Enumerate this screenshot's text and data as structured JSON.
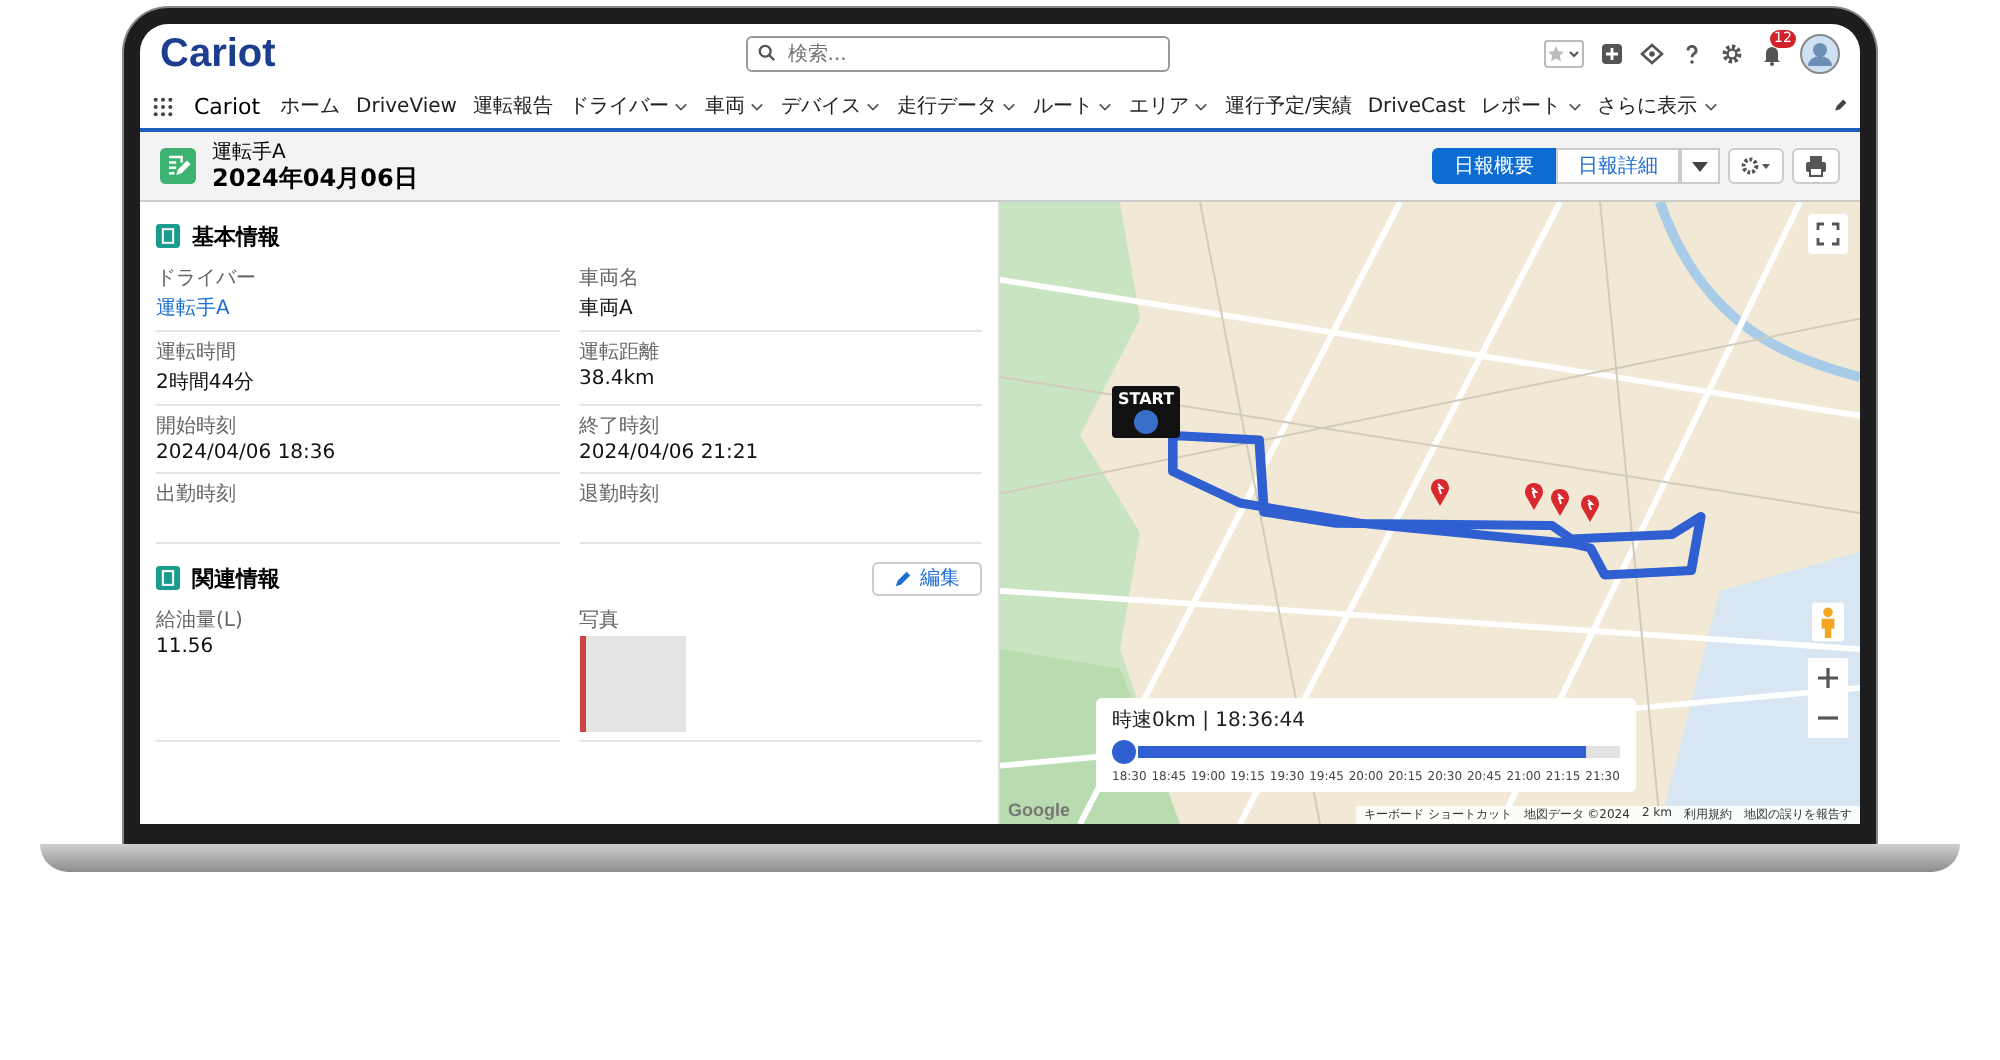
{
  "top_bar": {
    "logo": "Cariot",
    "search": {
      "placeholder": "検索..."
    },
    "notification_count": "12"
  },
  "nav": {
    "app_name": "Cariot",
    "items": [
      {
        "label": "ホーム",
        "has_menu": false
      },
      {
        "label": "DriveView",
        "has_menu": false
      },
      {
        "label": "運転報告",
        "has_menu": false
      },
      {
        "label": "ドライバー",
        "has_menu": true
      },
      {
        "label": "車両",
        "has_menu": true
      },
      {
        "label": "デバイス",
        "has_menu": true
      },
      {
        "label": "走行データ",
        "has_menu": true
      },
      {
        "label": "ルート",
        "has_menu": true
      },
      {
        "label": "エリア",
        "has_menu": true
      },
      {
        "label": "運行予定/実績",
        "has_menu": false
      },
      {
        "label": "DriveCast",
        "has_menu": false
      },
      {
        "label": "レポート",
        "has_menu": true
      },
      {
        "label": "さらに表示",
        "has_menu": true
      }
    ]
  },
  "record": {
    "object_label": "運転手A",
    "title": "2024年04月06日",
    "buttons": [
      {
        "label": "日報概要",
        "selected": true
      },
      {
        "label": "日報詳細",
        "selected": false
      }
    ]
  },
  "sections": [
    {
      "title": "基本情報",
      "fields": [
        {
          "label": "ドライバー",
          "kind": "link",
          "value": "運転手A"
        },
        {
          "label": "車両名",
          "kind": "text",
          "value": "車両A"
        },
        {
          "label": "運転時間",
          "kind": "text",
          "value": "2時間44分"
        },
        {
          "label": "運転距離",
          "kind": "text",
          "value": "38.4km"
        },
        {
          "label": "開始時刻",
          "kind": "text",
          "value": "2024/04/06 18:36"
        },
        {
          "label": "終了時刻",
          "kind": "text",
          "value": "2024/04/06 21:21"
        },
        {
          "label": "出勤時刻",
          "kind": "text"
        },
        {
          "label": "退勤時刻",
          "kind": "text"
        }
      ]
    },
    {
      "title": "関連情報",
      "edit_button": "編集",
      "fields": [
        {
          "label": "給油量(L)",
          "kind": "text",
          "value": "11.56"
        },
        {
          "label": "写真",
          "kind": "photo"
        }
      ]
    }
  ],
  "map": {
    "start_label": "START",
    "timeline": {
      "readout": "時速0km | 18:36:44",
      "level": 0.93,
      "ticks": [
        "18:30",
        "18:45",
        "19:00",
        "19:15",
        "19:30",
        "19:45",
        "20:00",
        "20:15",
        "20:30",
        "20:45",
        "21:00",
        "21:15",
        "21:30"
      ]
    },
    "google_logo": "Google",
    "footer": [
      "キーボード ショートカット",
      "地図データ ©2024",
      "2 km",
      "利用規約",
      "地図の誤りを報告す"
    ]
  }
}
